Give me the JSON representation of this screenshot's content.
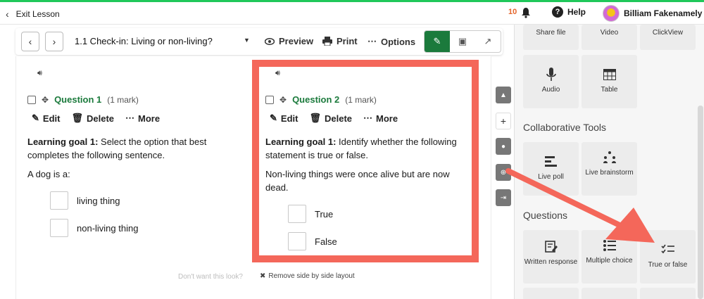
{
  "topbar": {
    "exit_label": "Exit Lesson",
    "notification_count": "10",
    "help_label": "Help",
    "user_name": "Billiam Fakenamely"
  },
  "toolbar": {
    "lesson_title": "1.1 Check-in: Living or non-living?",
    "preview_label": "Preview",
    "print_label": "Print",
    "options_label": "Options"
  },
  "questions": [
    {
      "title": "Question 1",
      "marks": "(1 mark)",
      "edit": "Edit",
      "delete": "Delete",
      "more": "More",
      "goal_label": "Learning goal 1:",
      "goal_text": " Select the option that best completes the following sentence.",
      "prompt": "A dog is a:",
      "options": [
        "living thing",
        "non-living thing"
      ]
    },
    {
      "title": "Question 2",
      "marks": "(1 mark)",
      "edit": "Edit",
      "delete": "Delete",
      "more": "More",
      "goal_label": "Learning goal 1:",
      "goal_text": " Identify whether the following statement is true or false.",
      "prompt": "Non-living things were once alive but are now dead.",
      "options": [
        "True",
        "False"
      ]
    }
  ],
  "footer": {
    "note": "Don't want this look?",
    "remove_layout": "Remove side by side layout"
  },
  "panel": {
    "top_tiles": [
      "Share file",
      "Video",
      "ClickView"
    ],
    "media_tiles": [
      "Audio",
      "Table"
    ],
    "collab_heading": "Collaborative Tools",
    "collab_tiles": [
      "Live poll",
      "Live brainstorm"
    ],
    "questions_heading": "Questions",
    "question_tiles": [
      "Written response",
      "Multiple choice",
      "True or false"
    ]
  },
  "colors": {
    "accent_green": "#1b7a3c",
    "highlight": "#f4675a",
    "top_line": "#1fc85a"
  }
}
